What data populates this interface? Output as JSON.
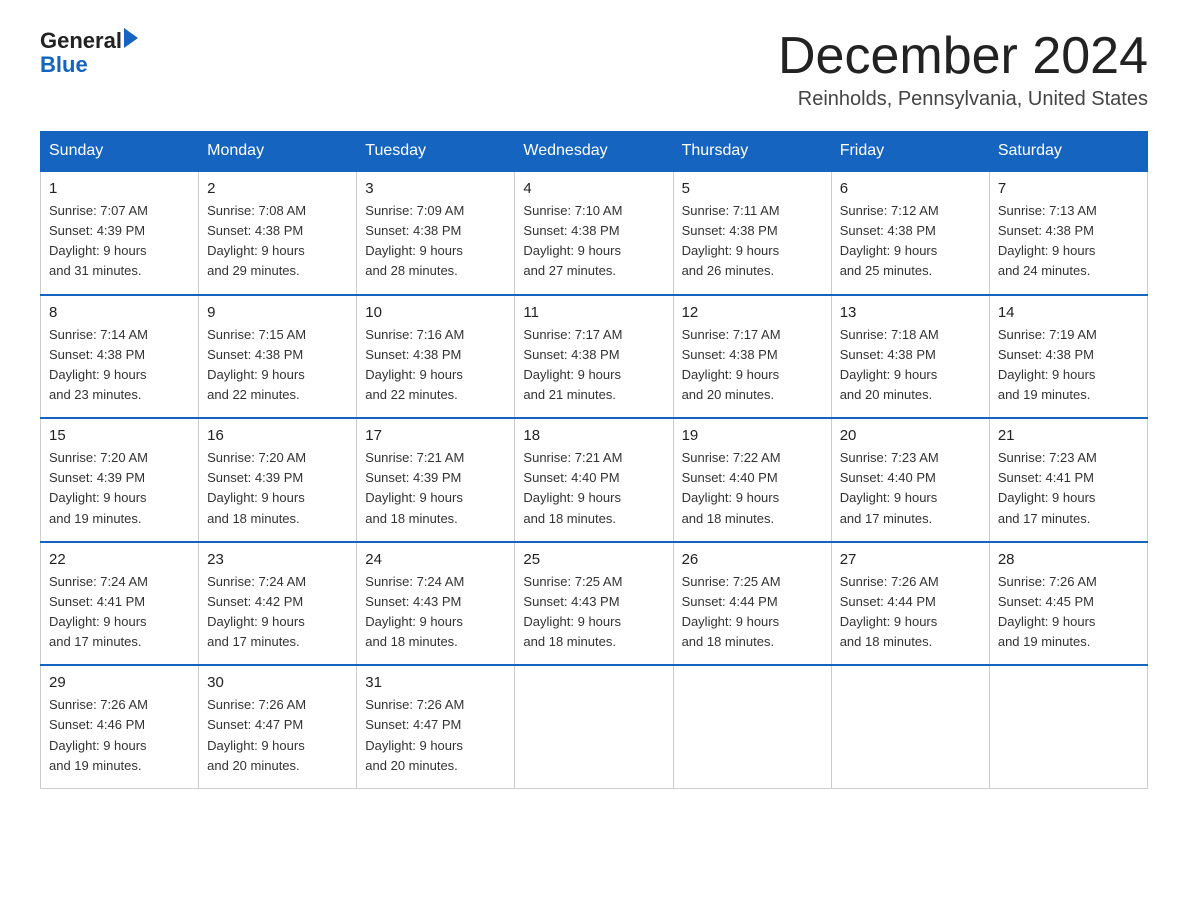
{
  "header": {
    "logo_line1": "General",
    "logo_line2": "Blue",
    "month_title": "December 2024",
    "location": "Reinholds, Pennsylvania, United States"
  },
  "days_of_week": [
    "Sunday",
    "Monday",
    "Tuesday",
    "Wednesday",
    "Thursday",
    "Friday",
    "Saturday"
  ],
  "weeks": [
    [
      {
        "num": "1",
        "sunrise": "7:07 AM",
        "sunset": "4:39 PM",
        "daylight": "9 hours and 31 minutes."
      },
      {
        "num": "2",
        "sunrise": "7:08 AM",
        "sunset": "4:38 PM",
        "daylight": "9 hours and 29 minutes."
      },
      {
        "num": "3",
        "sunrise": "7:09 AM",
        "sunset": "4:38 PM",
        "daylight": "9 hours and 28 minutes."
      },
      {
        "num": "4",
        "sunrise": "7:10 AM",
        "sunset": "4:38 PM",
        "daylight": "9 hours and 27 minutes."
      },
      {
        "num": "5",
        "sunrise": "7:11 AM",
        "sunset": "4:38 PM",
        "daylight": "9 hours and 26 minutes."
      },
      {
        "num": "6",
        "sunrise": "7:12 AM",
        "sunset": "4:38 PM",
        "daylight": "9 hours and 25 minutes."
      },
      {
        "num": "7",
        "sunrise": "7:13 AM",
        "sunset": "4:38 PM",
        "daylight": "9 hours and 24 minutes."
      }
    ],
    [
      {
        "num": "8",
        "sunrise": "7:14 AM",
        "sunset": "4:38 PM",
        "daylight": "9 hours and 23 minutes."
      },
      {
        "num": "9",
        "sunrise": "7:15 AM",
        "sunset": "4:38 PM",
        "daylight": "9 hours and 22 minutes."
      },
      {
        "num": "10",
        "sunrise": "7:16 AM",
        "sunset": "4:38 PM",
        "daylight": "9 hours and 22 minutes."
      },
      {
        "num": "11",
        "sunrise": "7:17 AM",
        "sunset": "4:38 PM",
        "daylight": "9 hours and 21 minutes."
      },
      {
        "num": "12",
        "sunrise": "7:17 AM",
        "sunset": "4:38 PM",
        "daylight": "9 hours and 20 minutes."
      },
      {
        "num": "13",
        "sunrise": "7:18 AM",
        "sunset": "4:38 PM",
        "daylight": "9 hours and 20 minutes."
      },
      {
        "num": "14",
        "sunrise": "7:19 AM",
        "sunset": "4:38 PM",
        "daylight": "9 hours and 19 minutes."
      }
    ],
    [
      {
        "num": "15",
        "sunrise": "7:20 AM",
        "sunset": "4:39 PM",
        "daylight": "9 hours and 19 minutes."
      },
      {
        "num": "16",
        "sunrise": "7:20 AM",
        "sunset": "4:39 PM",
        "daylight": "9 hours and 18 minutes."
      },
      {
        "num": "17",
        "sunrise": "7:21 AM",
        "sunset": "4:39 PM",
        "daylight": "9 hours and 18 minutes."
      },
      {
        "num": "18",
        "sunrise": "7:21 AM",
        "sunset": "4:40 PM",
        "daylight": "9 hours and 18 minutes."
      },
      {
        "num": "19",
        "sunrise": "7:22 AM",
        "sunset": "4:40 PM",
        "daylight": "9 hours and 18 minutes."
      },
      {
        "num": "20",
        "sunrise": "7:23 AM",
        "sunset": "4:40 PM",
        "daylight": "9 hours and 17 minutes."
      },
      {
        "num": "21",
        "sunrise": "7:23 AM",
        "sunset": "4:41 PM",
        "daylight": "9 hours and 17 minutes."
      }
    ],
    [
      {
        "num": "22",
        "sunrise": "7:24 AM",
        "sunset": "4:41 PM",
        "daylight": "9 hours and 17 minutes."
      },
      {
        "num": "23",
        "sunrise": "7:24 AM",
        "sunset": "4:42 PM",
        "daylight": "9 hours and 17 minutes."
      },
      {
        "num": "24",
        "sunrise": "7:24 AM",
        "sunset": "4:43 PM",
        "daylight": "9 hours and 18 minutes."
      },
      {
        "num": "25",
        "sunrise": "7:25 AM",
        "sunset": "4:43 PM",
        "daylight": "9 hours and 18 minutes."
      },
      {
        "num": "26",
        "sunrise": "7:25 AM",
        "sunset": "4:44 PM",
        "daylight": "9 hours and 18 minutes."
      },
      {
        "num": "27",
        "sunrise": "7:26 AM",
        "sunset": "4:44 PM",
        "daylight": "9 hours and 18 minutes."
      },
      {
        "num": "28",
        "sunrise": "7:26 AM",
        "sunset": "4:45 PM",
        "daylight": "9 hours and 19 minutes."
      }
    ],
    [
      {
        "num": "29",
        "sunrise": "7:26 AM",
        "sunset": "4:46 PM",
        "daylight": "9 hours and 19 minutes."
      },
      {
        "num": "30",
        "sunrise": "7:26 AM",
        "sunset": "4:47 PM",
        "daylight": "9 hours and 20 minutes."
      },
      {
        "num": "31",
        "sunrise": "7:26 AM",
        "sunset": "4:47 PM",
        "daylight": "9 hours and 20 minutes."
      },
      null,
      null,
      null,
      null
    ]
  ],
  "labels": {
    "sunrise": "Sunrise:",
    "sunset": "Sunset:",
    "daylight": "Daylight:"
  }
}
